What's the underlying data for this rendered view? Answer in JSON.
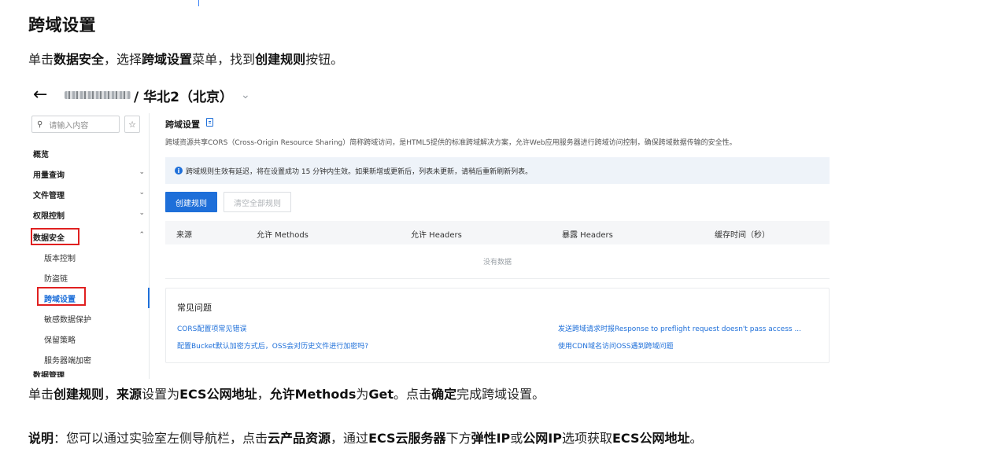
{
  "doc": {
    "title": "跨域设置",
    "line1": [
      {
        "text": "单击",
        "bold": false
      },
      {
        "text": "数据安全",
        "bold": true
      },
      {
        "text": "，选择",
        "bold": false
      },
      {
        "text": "跨域设置",
        "bold": true
      },
      {
        "text": "菜单，找到",
        "bold": false
      },
      {
        "text": "创建规则",
        "bold": true
      },
      {
        "text": "按钮。",
        "bold": false
      }
    ],
    "line2": [
      {
        "text": "单击",
        "bold": false
      },
      {
        "text": "创建规则",
        "bold": true
      },
      {
        "text": "，",
        "bold": false
      },
      {
        "text": "来源",
        "bold": true
      },
      {
        "text": "设置为",
        "bold": false
      },
      {
        "text": "ECS公网地址",
        "bold": true
      },
      {
        "text": "，",
        "bold": false
      },
      {
        "text": "允许Methods",
        "bold": true
      },
      {
        "text": "为",
        "bold": false
      },
      {
        "text": "Get",
        "bold": true
      },
      {
        "text": "。点击",
        "bold": false
      },
      {
        "text": "确定",
        "bold": true
      },
      {
        "text": "完成跨域设置。",
        "bold": false
      }
    ],
    "line3": [
      {
        "text": "说明",
        "bold": true
      },
      {
        "text": "：您可以通过实验室左侧导航栏，点击",
        "bold": false
      },
      {
        "text": "云产品资源",
        "bold": true
      },
      {
        "text": "，通过",
        "bold": false
      },
      {
        "text": "ECS云服务器",
        "bold": true
      },
      {
        "text": "下方",
        "bold": false
      },
      {
        "text": "弹性IP",
        "bold": true
      },
      {
        "text": "或",
        "bold": false
      },
      {
        "text": "公网IP",
        "bold": true
      },
      {
        "text": "选项获取",
        "bold": false
      },
      {
        "text": "ECS公网地址",
        "bold": true
      },
      {
        "text": "。",
        "bold": false
      }
    ]
  },
  "console": {
    "back_icon": "back-arrow-icon",
    "region": "/ 华北2（北京）",
    "search_placeholder": "请输入内容",
    "sidebar": {
      "overview": "概览",
      "usage": "用量查询",
      "files": "文件管理",
      "permissions": "权限控制",
      "data_security": "数据安全",
      "sub_items": [
        "版本控制",
        "防盗链",
        "跨域设置",
        "敏感数据保护",
        "保留策略",
        "服务器端加密"
      ],
      "cut_item": "数据管理"
    },
    "page_title": "跨域设置",
    "page_desc": "跨域资源共享CORS（Cross-Origin Resource Sharing）简称跨域访问，是HTML5提供的标准跨域解决方案，允许Web应用服务器进行跨域访问控制，确保跨域数据传输的安全性。",
    "notice": "跨域规则生效有延迟，将在设置成功 15 分钟内生效。如果新增或更新后，列表未更新，请稍后重新刷新列表。",
    "create_rule": "创建规则",
    "clear_all": "清空全部规则",
    "columns": [
      "来源",
      "允许 Methods",
      "允许 Headers",
      "暴露 Headers",
      "缓存时间（秒）"
    ],
    "empty": "没有数据",
    "faq_title": "常见问题",
    "faq_links": [
      "CORS配置项常见错误",
      "发送跨域请求时报Response to preflight request doesn't pass access ...",
      "配置Bucket默认加密方式后，OSS会对历史文件进行加密吗?",
      "使用CDN域名访问OSS遇到跨域问题"
    ],
    "accent_color": "#1e6fd9",
    "highlight_color": "#e02020"
  }
}
